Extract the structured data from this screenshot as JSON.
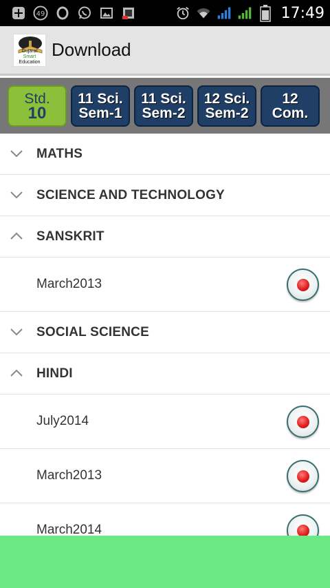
{
  "status_bar": {
    "notification_count": "49",
    "time": "17:49"
  },
  "app_bar": {
    "title": "Download",
    "logo_lines": [
      "Gujarat",
      "Smart",
      "Education"
    ]
  },
  "tabs": [
    {
      "line1": "Std.",
      "line2": "10",
      "active": true
    },
    {
      "line1": "11 Sci.",
      "line2": "Sem-1",
      "active": false
    },
    {
      "line1": "11 Sci.",
      "line2": "Sem-2",
      "active": false
    },
    {
      "line1": "12 Sci.",
      "line2": "Sem-2",
      "active": false
    },
    {
      "line1": "12",
      "line2": "Com.",
      "active": false
    }
  ],
  "list": {
    "groups": [
      {
        "label": "MATHS",
        "expanded": false,
        "items": []
      },
      {
        "label": "SCIENCE AND TECHNOLOGY",
        "expanded": false,
        "items": []
      },
      {
        "label": "SANSKRIT",
        "expanded": true,
        "items": [
          "March2013"
        ]
      },
      {
        "label": "SOCIAL SCIENCE",
        "expanded": false,
        "items": []
      },
      {
        "label": "HINDI",
        "expanded": true,
        "items": [
          "July2014",
          "March2013",
          "March2014"
        ]
      }
    ]
  },
  "colors": {
    "active_tab": "#8cc03a",
    "inactive_tab": "#1f3f66",
    "banner": "#6ce982"
  }
}
